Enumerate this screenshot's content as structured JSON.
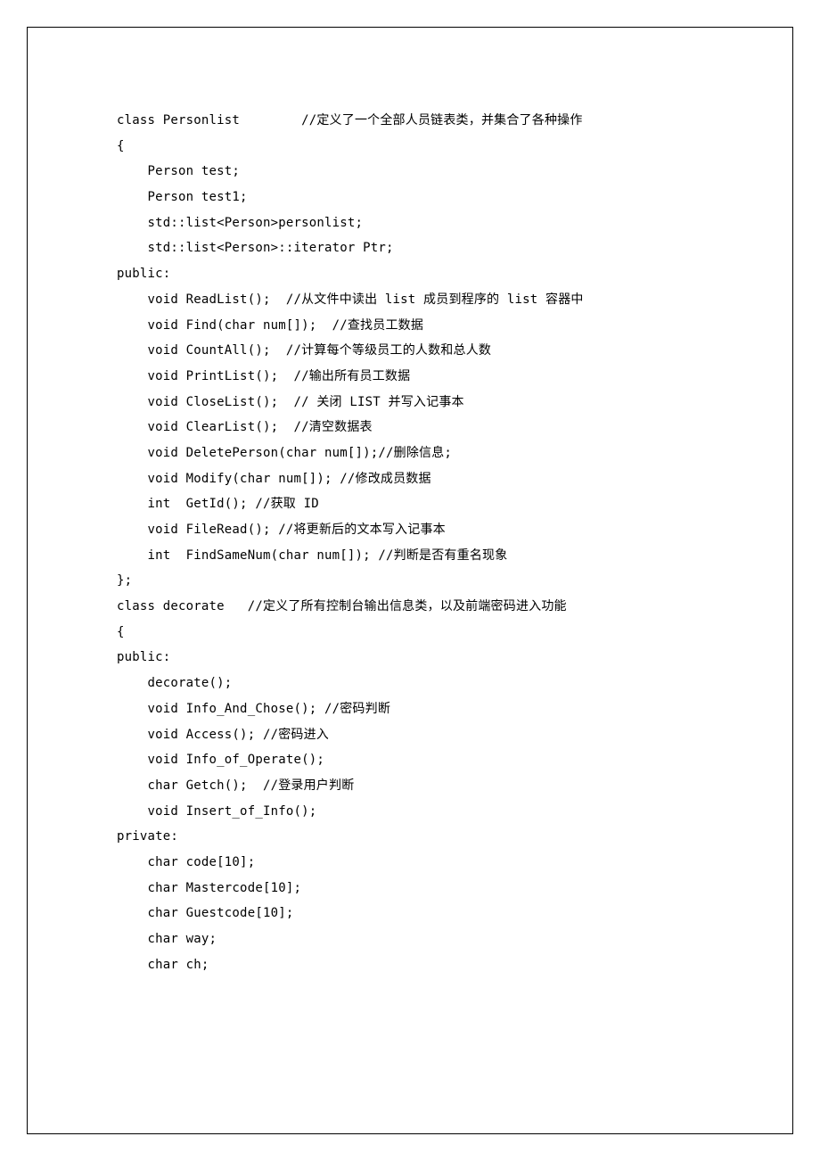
{
  "code": {
    "lines": [
      "class Personlist        //定义了一个全部人员链表类，并集合了各种操作",
      "{",
      "    Person test;",
      "    Person test1;",
      "    std::list<Person>personlist;",
      "    std::list<Person>::iterator Ptr;",
      "public:",
      "    void ReadList();  //从文件中读出 list 成员到程序的 list 容器中",
      "    void Find(char num[]);  //查找员工数据",
      "    void CountAll();  //计算每个等级员工的人数和总人数",
      "    void PrintList();  //输出所有员工数据",
      "    void CloseList();  // 关闭 LIST 并写入记事本",
      "    void ClearList();  //清空数据表",
      "    void DeletePerson(char num[]);//删除信息;",
      "    void Modify(char num[]); //修改成员数据",
      "    int  GetId(); //获取 ID",
      "    void FileRead(); //将更新后的文本写入记事本",
      "    int  FindSameNum(char num[]); //判断是否有重名现象",
      "};",
      "class decorate   //定义了所有控制台输出信息类，以及前端密码进入功能",
      "{",
      "public:",
      "    decorate();",
      "    void Info_And_Chose(); //密码判断",
      "    void Access(); //密码进入",
      "    void Info_of_Operate();",
      "    char Getch();  //登录用户判断",
      "    void Insert_of_Info();",
      "private:",
      "    char code[10];",
      "    char Mastercode[10];",
      "    char Guestcode[10];",
      "    char way;",
      "    char ch;"
    ]
  }
}
